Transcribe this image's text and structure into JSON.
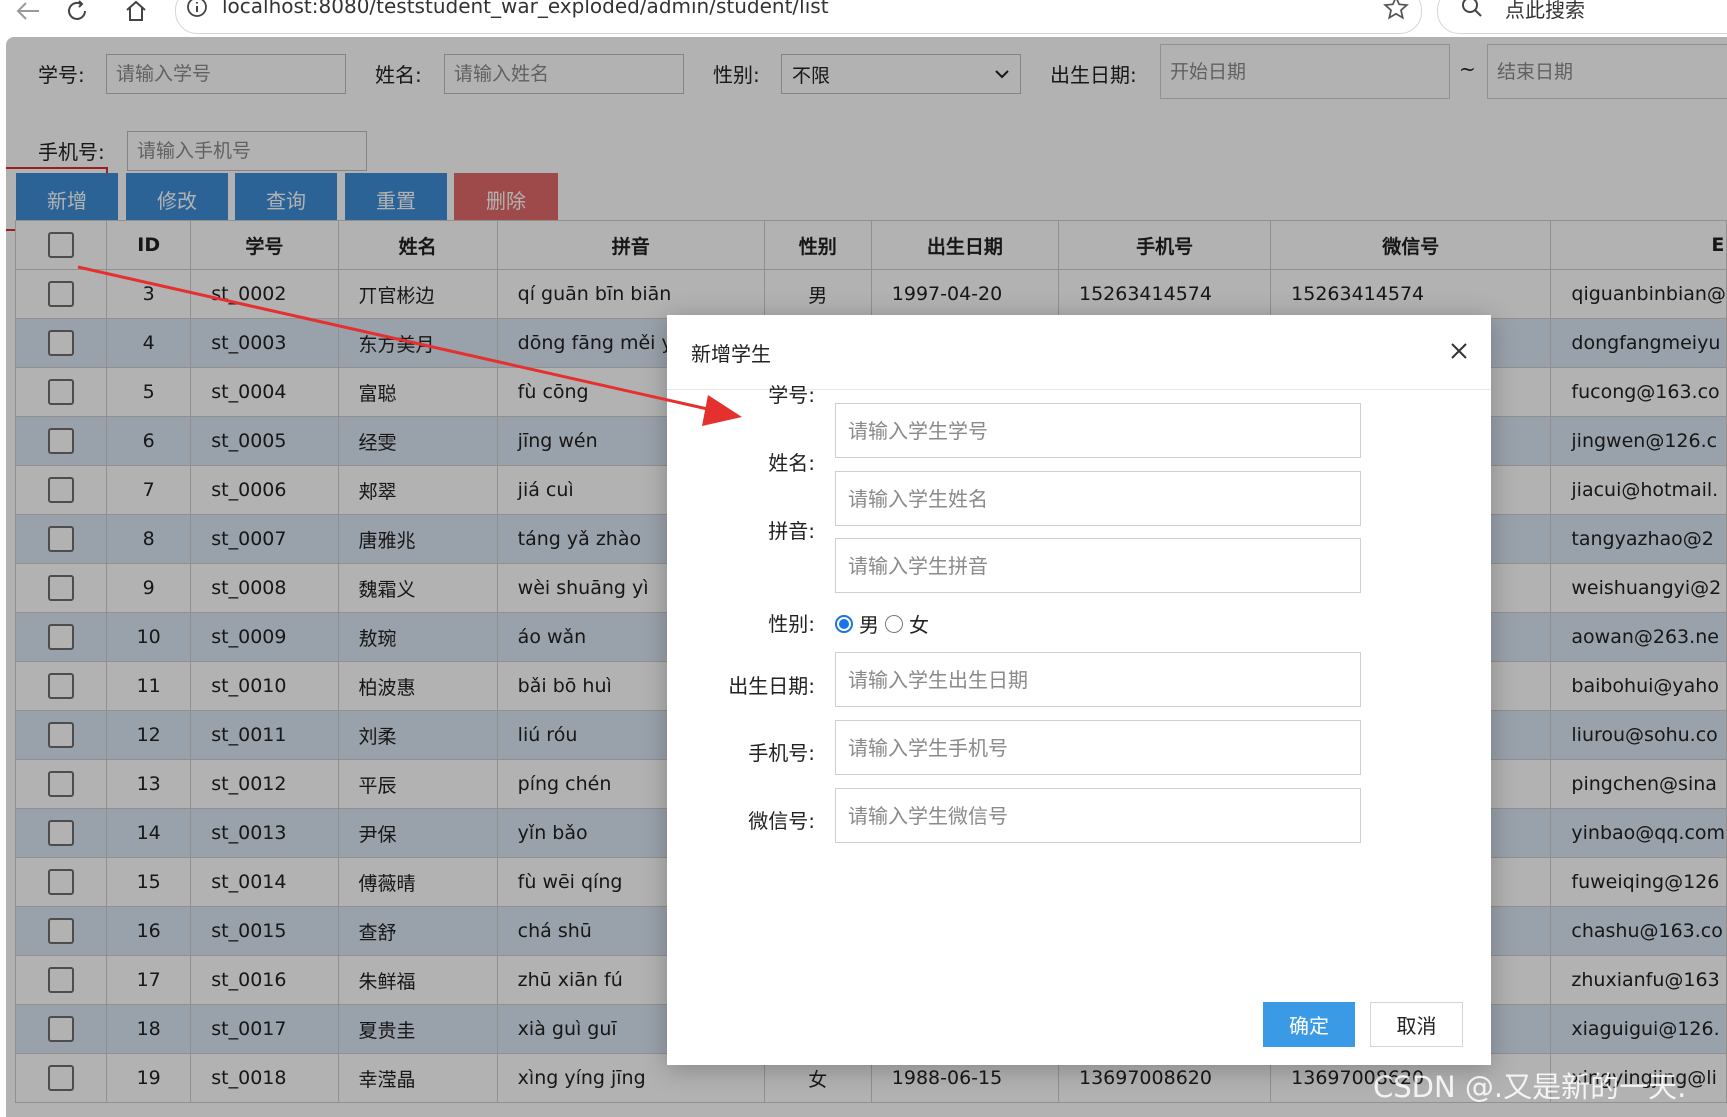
{
  "browser": {
    "url": "localhost:8080/teststudent_war_exploded/admin/student/list",
    "search_placeholder": "点此搜索"
  },
  "filters": {
    "student_no_label": "学号:",
    "student_no_placeholder": "请输入学号",
    "name_label": "姓名:",
    "name_placeholder": "请输入姓名",
    "gender_label": "性别:",
    "gender_value": "不限",
    "birth_label": "出生日期:",
    "birth_start_placeholder": "开始日期",
    "birth_sep": "~",
    "birth_end_placeholder": "结束日期",
    "phone_label": "手机号:",
    "phone_placeholder": "请输入手机号"
  },
  "toolbar": {
    "add": "新增",
    "edit": "修改",
    "query": "查询",
    "reset": "重置",
    "delete": "删除"
  },
  "table": {
    "headers": {
      "id": "ID",
      "no": "学号",
      "name": "姓名",
      "pinyin": "拼音",
      "gender": "性别",
      "birth": "出生日期",
      "phone": "手机号",
      "wechat": "微信号",
      "email": "E"
    },
    "rows": [
      {
        "id": "3",
        "no": "st_0002",
        "name": "丌官彬边",
        "pinyin": "qí guān bīn biān",
        "gender": "男",
        "birth": "1997-04-20",
        "phone": "15263414574",
        "wechat": "15263414574",
        "email": "qiguanbinbian@"
      },
      {
        "id": "4",
        "no": "st_0003",
        "name": "东方美月",
        "pinyin": "dōng fāng měi yuè",
        "gender": "",
        "birth": "",
        "phone": "",
        "wechat": "",
        "email": "dongfangmeiyu"
      },
      {
        "id": "5",
        "no": "st_0004",
        "name": "富聪",
        "pinyin": "fù cōng",
        "gender": "",
        "birth": "",
        "phone": "",
        "wechat": "",
        "email": "fucong@163.co"
      },
      {
        "id": "6",
        "no": "st_0005",
        "name": "经雯",
        "pinyin": "jīng wén",
        "gender": "",
        "birth": "",
        "phone": "",
        "wechat": "",
        "email": "jingwen@126.c"
      },
      {
        "id": "7",
        "no": "st_0006",
        "name": "郏翠",
        "pinyin": "jiá cuì",
        "gender": "",
        "birth": "",
        "phone": "",
        "wechat": "",
        "email": "jiacui@hotmail."
      },
      {
        "id": "8",
        "no": "st_0007",
        "name": "唐雅兆",
        "pinyin": "táng yǎ zhào",
        "gender": "",
        "birth": "",
        "phone": "",
        "wechat": "",
        "email": "tangyazhao@2"
      },
      {
        "id": "9",
        "no": "st_0008",
        "name": "魏霜义",
        "pinyin": "wèi shuāng yì",
        "gender": "",
        "birth": "",
        "phone": "",
        "wechat": "",
        "email": "weishuangyi@2"
      },
      {
        "id": "10",
        "no": "st_0009",
        "name": "敖琬",
        "pinyin": "áo wǎn",
        "gender": "",
        "birth": "",
        "phone": "",
        "wechat": "",
        "email": "aowan@263.ne"
      },
      {
        "id": "11",
        "no": "st_0010",
        "name": "柏波惠",
        "pinyin": "bǎi bō huì",
        "gender": "",
        "birth": "",
        "phone": "",
        "wechat": "",
        "email": "baibohui@yaho"
      },
      {
        "id": "12",
        "no": "st_0011",
        "name": "刘柔",
        "pinyin": "liú róu",
        "gender": "",
        "birth": "",
        "phone": "",
        "wechat": "",
        "email": "liurou@sohu.co"
      },
      {
        "id": "13",
        "no": "st_0012",
        "name": "平辰",
        "pinyin": "píng chén",
        "gender": "",
        "birth": "",
        "phone": "",
        "wechat": "",
        "email": "pingchen@sina"
      },
      {
        "id": "14",
        "no": "st_0013",
        "name": "尹保",
        "pinyin": "yǐn bǎo",
        "gender": "",
        "birth": "",
        "phone": "",
        "wechat": "",
        "email": "yinbao@qq.com"
      },
      {
        "id": "15",
        "no": "st_0014",
        "name": "傅薇晴",
        "pinyin": "fù wēi qíng",
        "gender": "",
        "birth": "",
        "phone": "",
        "wechat": "",
        "email": "fuweiqing@126"
      },
      {
        "id": "16",
        "no": "st_0015",
        "name": "查舒",
        "pinyin": "chá shū",
        "gender": "",
        "birth": "",
        "phone": "",
        "wechat": "",
        "email": "chashu@163.co"
      },
      {
        "id": "17",
        "no": "st_0016",
        "name": "朱鲜福",
        "pinyin": "zhū xiān fú",
        "gender": "",
        "birth": "",
        "phone": "",
        "wechat": "",
        "email": "zhuxianfu@163"
      },
      {
        "id": "18",
        "no": "st_0017",
        "name": "夏贵圭",
        "pinyin": "xià guì guī",
        "gender": "",
        "birth": "",
        "phone": "",
        "wechat": "",
        "email": "xiaguigui@126."
      },
      {
        "id": "19",
        "no": "st_0018",
        "name": "幸滢晶",
        "pinyin": "xìng yíng jīng",
        "gender": "女",
        "birth": "1988-06-15",
        "phone": "13697008620",
        "wechat": "13697008620",
        "email": "xingyingjing@li"
      }
    ]
  },
  "modal": {
    "title": "新增学生",
    "fields": {
      "no_label": "学号:",
      "no_placeholder": "请输入学生学号",
      "name_label": "姓名:",
      "name_placeholder": "请输入学生姓名",
      "pinyin_label": "拼音:",
      "pinyin_placeholder": "请输入学生拼音",
      "gender_label": "性别:",
      "gender_male": "男",
      "gender_female": "女",
      "gender_selected": "男",
      "birth_label": "出生日期:",
      "birth_placeholder": "请输入学生出生日期",
      "phone_label": "手机号:",
      "phone_placeholder": "请输入学生手机号",
      "wechat_label": "微信号:",
      "wechat_placeholder": "请输入学生微信号"
    },
    "ok": "确定",
    "cancel": "取消"
  },
  "watermark": "CSDN @.又是新的一天.",
  "colors": {
    "primary_button": "#3f8fd8",
    "danger_button": "#e46a6a",
    "confirm_button": "#3b9ae6",
    "annotation_red": "#e02b2b",
    "row_stripe": "#dbe7f5"
  }
}
